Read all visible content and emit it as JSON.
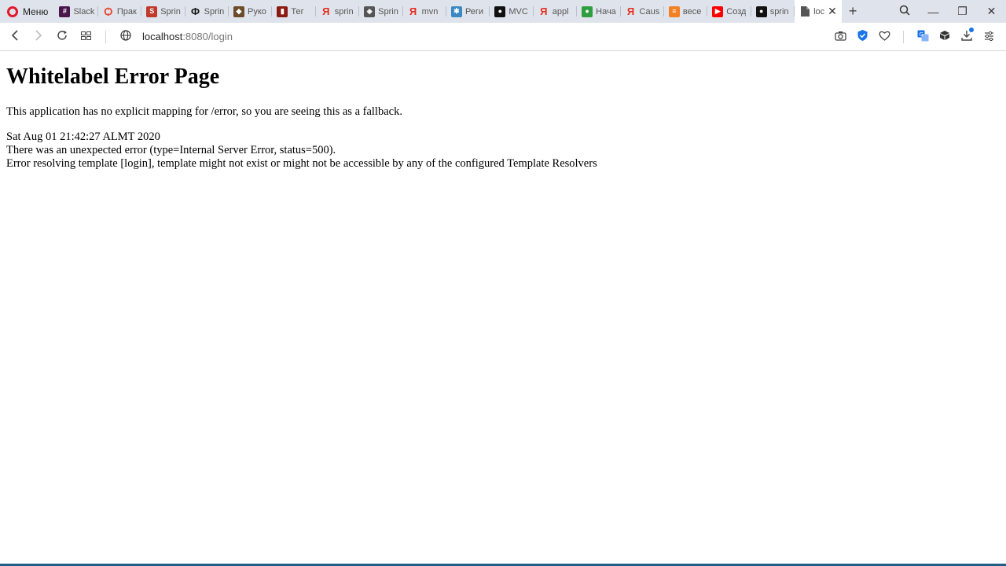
{
  "browser": {
    "menu_label": "Меню",
    "tabs": [
      {
        "label": "Slack",
        "icon": "slack-icon",
        "color": "#4a154b",
        "glyph": "#"
      },
      {
        "label": "Прак",
        "icon": "letter-icon",
        "color": "#e8472f",
        "glyph": "Ѻ"
      },
      {
        "label": "Sprin",
        "icon": "spring-icon",
        "color": "#c0392b",
        "glyph": "S"
      },
      {
        "label": "Sprin",
        "icon": "spring-icon",
        "color": "#111111",
        "glyph": "Ф"
      },
      {
        "label": "Руко",
        "icon": "bird-icon",
        "color": "#6b4b2a",
        "glyph": "◆"
      },
      {
        "label": "Тег",
        "icon": "tag-icon",
        "color": "#8b1a10",
        "glyph": "▮"
      },
      {
        "label": "sprin",
        "icon": "yandex-icon",
        "color": "#e62e1f",
        "glyph": "Я"
      },
      {
        "label": "Sprin",
        "icon": "diamond-icon",
        "color": "#555555",
        "glyph": "◈"
      },
      {
        "label": "mvn",
        "icon": "yandex-icon",
        "color": "#e62e1f",
        "glyph": "Я"
      },
      {
        "label": "Реги",
        "icon": "puzzle-icon",
        "color": "#3b88c3",
        "glyph": "✱"
      },
      {
        "label": "MVC",
        "icon": "github-icon",
        "color": "#111111",
        "glyph": "●"
      },
      {
        "label": "appl",
        "icon": "yandex-icon",
        "color": "#e62e1f",
        "glyph": "Я"
      },
      {
        "label": "Нача",
        "icon": "leaf-icon",
        "color": "#2e9e3e",
        "glyph": "●"
      },
      {
        "label": "Caus",
        "icon": "yandex-icon",
        "color": "#e62e1f",
        "glyph": "Я"
      },
      {
        "label": "весе",
        "icon": "stack-icon",
        "color": "#f48024",
        "glyph": "≡"
      },
      {
        "label": "Созд",
        "icon": "youtube-icon",
        "color": "#ff0000",
        "glyph": "▶"
      },
      {
        "label": "sprin",
        "icon": "github-icon",
        "color": "#111111",
        "glyph": "●"
      }
    ],
    "active_tab": {
      "label": "loc",
      "icon": "document-icon"
    },
    "address": {
      "host": "localhost",
      "path": ":8080/login"
    }
  },
  "page": {
    "title": "Whitelabel Error Page",
    "message": "This application has no explicit mapping for /error, so you are seeing this as a fallback.",
    "timestamp": "Sat Aug 01 21:42:27 ALMT 2020",
    "error_line": "There was an unexpected error (type=Internal Server Error, status=500).",
    "detail_line": "Error resolving template [login], template might not exist or might not be accessible by any of the configured Template Resolvers"
  }
}
